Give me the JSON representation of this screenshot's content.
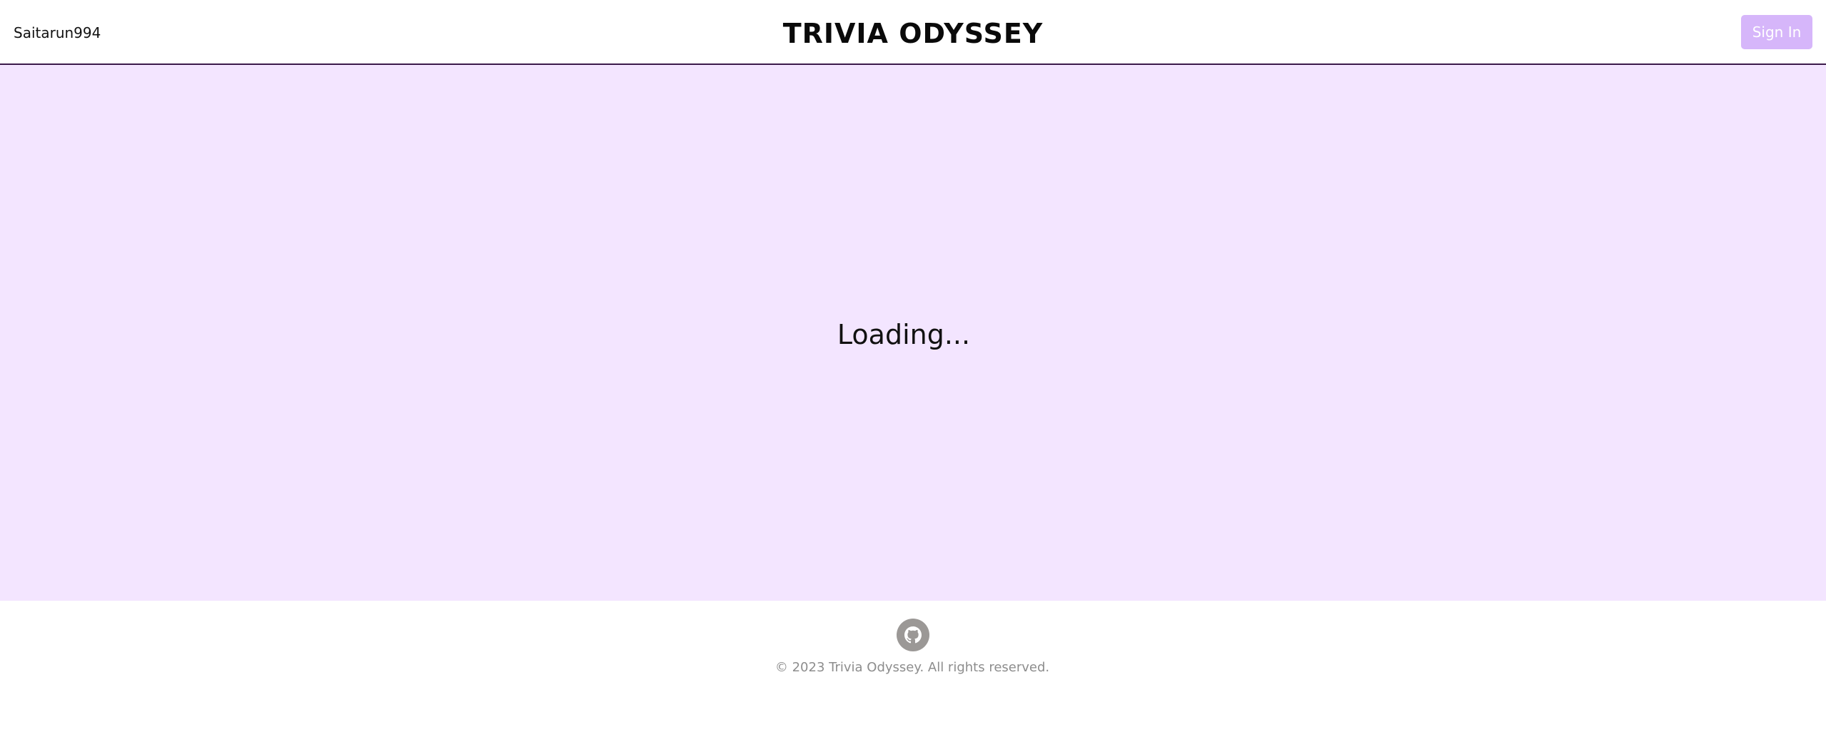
{
  "header": {
    "username": "Saitarun994",
    "title": "TRIVIA ODYSSEY",
    "sign_in_label": "Sign In"
  },
  "main": {
    "status_text": "Loading..."
  },
  "footer": {
    "icon": "github-icon",
    "copyright": "© 2023 Trivia Odyssey. All rights reserved."
  },
  "colors": {
    "main_background": "#f3e5ff",
    "sign_in_button": "#d6b6fa",
    "header_border": "#3b1a4a",
    "github_icon_bg": "#9b9896",
    "footer_text": "#8d8d8d"
  }
}
